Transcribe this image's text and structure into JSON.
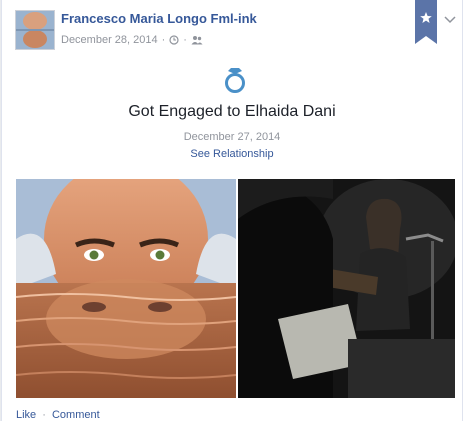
{
  "post": {
    "author": "Francesco Maria Longo Fml-ink",
    "date": "December 28, 2014",
    "separator": "·",
    "icons": {
      "time": "clock-icon",
      "audience": "friends-icon",
      "ribbon": "star-ribbon-icon",
      "menu": "chevron-down-icon",
      "life_event": "ring-icon"
    }
  },
  "life_event": {
    "title": "Got Engaged to Elhaida Dani",
    "date": "December 27, 2014",
    "link": "See Relationship"
  },
  "actions": {
    "like": "Like",
    "separator": "·",
    "comment": "Comment"
  },
  "colors": {
    "link": "#365899",
    "ribbon": "#5b74a8",
    "ring": "#4a90c8",
    "meta": "#90949c"
  }
}
